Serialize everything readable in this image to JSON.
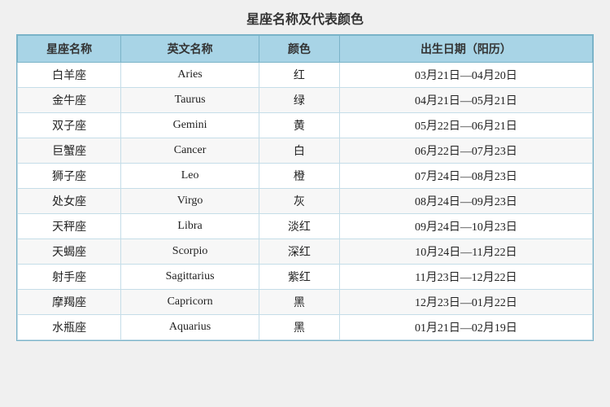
{
  "title": "星座名称及代表颜色",
  "headers": {
    "name": "星座名称",
    "english": "英文名称",
    "color": "颜色",
    "date": "出生日期（阳历）"
  },
  "rows": [
    {
      "name": "白羊座",
      "english": "Aries",
      "color": "红",
      "date": "03月21日—04月20日"
    },
    {
      "name": "金牛座",
      "english": "Taurus",
      "color": "绿",
      "date": "04月21日—05月21日"
    },
    {
      "name": "双子座",
      "english": "Gemini",
      "color": "黄",
      "date": "05月22日—06月21日"
    },
    {
      "name": "巨蟹座",
      "english": "Cancer",
      "color": "白",
      "date": "06月22日—07月23日"
    },
    {
      "name": "狮子座",
      "english": "Leo",
      "color": "橙",
      "date": "07月24日—08月23日"
    },
    {
      "name": "处女座",
      "english": "Virgo",
      "color": "灰",
      "date": "08月24日—09月23日"
    },
    {
      "name": "天秤座",
      "english": "Libra",
      "color": "淡红",
      "date": "09月24日—10月23日"
    },
    {
      "name": "天蝎座",
      "english": "Scorpio",
      "color": "深红",
      "date": "10月24日—11月22日"
    },
    {
      "name": "射手座",
      "english": "Sagittarius",
      "color": "紫红",
      "date": "11月23日—12月22日"
    },
    {
      "name": "摩羯座",
      "english": "Capricorn",
      "color": "黑",
      "date": "12月23日—01月22日"
    },
    {
      "name": "水瓶座",
      "english": "Aquarius",
      "color": "黑",
      "date": "01月21日—02月19日"
    }
  ]
}
